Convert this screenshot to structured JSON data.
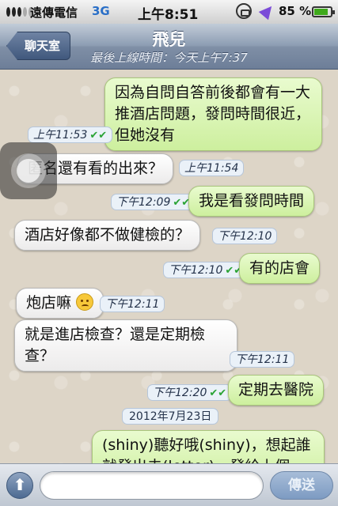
{
  "status_bar": {
    "carrier": "遠傳電信",
    "network": "3G",
    "time": "上午8:51",
    "battery_percent": "85 %",
    "battery_level": 0.85
  },
  "nav": {
    "back_label": "聊天室",
    "title": "飛兒",
    "subtitle": "最後上線時間：今天上午7:37"
  },
  "messages": [
    {
      "direction": "out",
      "text": "因為自問自答前後都會有一大推酒店問題，發問時間很近，但她沒有",
      "time": "上午11:53",
      "status": "read"
    },
    {
      "direction": "in",
      "text": "匿名還有看的出來？",
      "time": "上午11:54"
    },
    {
      "direction": "out",
      "text": "我是看發問時間",
      "time": "下午12:09",
      "status": "read"
    },
    {
      "direction": "in",
      "text": "酒店好像都不做健檢的？",
      "time": "下午12:10"
    },
    {
      "direction": "out",
      "text": "有的店會",
      "time": "下午12:10",
      "status": "read"
    },
    {
      "direction": "in",
      "text": "炮店嘛",
      "time": "下午12:11",
      "emoji": "unamused-face-emoji"
    },
    {
      "direction": "in",
      "text": "就是進店檢查？還是定期檢查？",
      "time": "下午12:11"
    },
    {
      "direction": "out",
      "text": "定期去醫院",
      "time": "下午12:20",
      "status": "read"
    },
    {
      "direction": "out",
      "text": "(shiny)聽好哦(shiny)，想起誰就發出去(letter)，發給上個",
      "partial": true
    }
  ],
  "date_separator": "2012年7月23日",
  "input_bar": {
    "placeholder": "",
    "send_label": "傳送",
    "attach_icon": "up-arrow-icon"
  },
  "colors": {
    "outgoing_bubble": "#d6f2b0",
    "incoming_bubble": "#ffffff",
    "read_check": "#2aa335",
    "nav_bar": "#8d9db3"
  }
}
